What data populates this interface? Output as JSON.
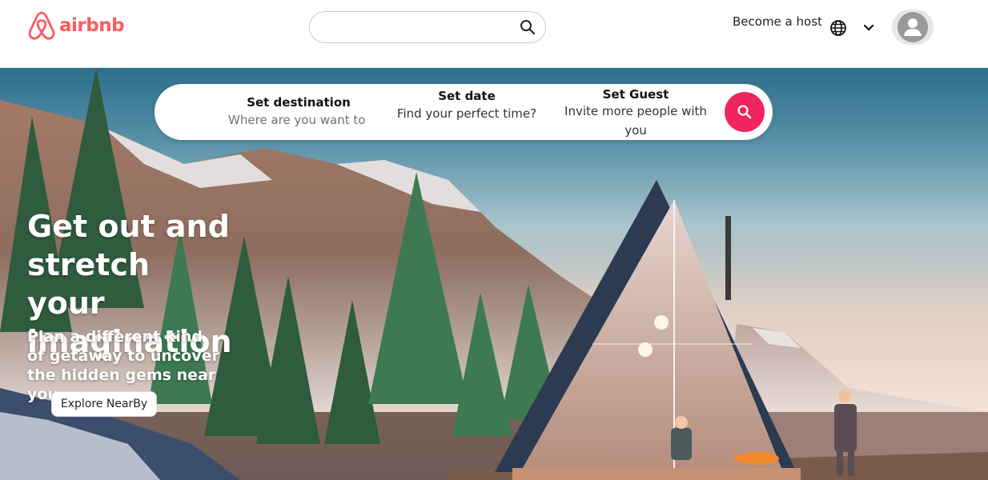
{
  "brand": {
    "name": "airbnb",
    "color": "#ff5a5f",
    "logo_icon": "airbnb-belo-icon"
  },
  "header": {
    "search": {
      "value": "",
      "placeholder": "",
      "icon": "search-icon"
    },
    "host_link": "Become a host",
    "language_icon": "globe-icon",
    "menu_icon": "chevron-down-icon",
    "profile_icon": "user-avatar-icon"
  },
  "search_pill": {
    "destination": {
      "title": "Set destination",
      "placeholder": "Where are you want to g"
    },
    "date": {
      "title": "Set date",
      "subtitle": "Find your perfect time?"
    },
    "guest": {
      "title": "Set Guest",
      "subtitle": "Invite more people with you"
    },
    "search_button_color": "#f0245e",
    "search_button_icon": "search-icon"
  },
  "hero": {
    "title": "Get out and stretch your imagination",
    "subtitle": "Plan a different kind of getaway to uncover the hidden gems near you",
    "cta": "Explore NearBy"
  }
}
